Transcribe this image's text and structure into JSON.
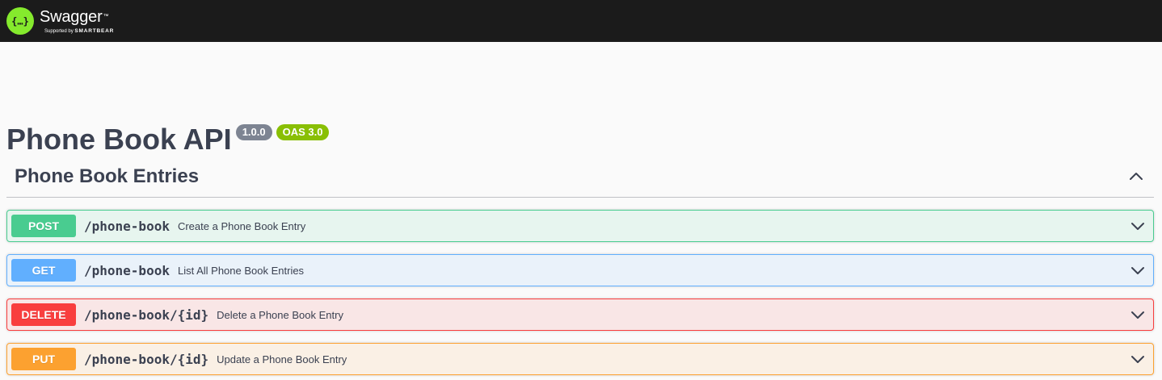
{
  "topbar": {
    "brand": "Swagger",
    "trademark": "™",
    "tagline_prefix": "Supported by",
    "tagline_brand": "SMARTBEAR",
    "logo_glyph": "{…}"
  },
  "info": {
    "title": "Phone Book API",
    "version": "1.0.0",
    "oas": "OAS 3.0"
  },
  "section": {
    "title": "Phone Book Entries",
    "toggle_icon": "chevron-up-icon"
  },
  "operations": [
    {
      "method": "POST",
      "path": "/phone-book",
      "summary": "Create a Phone Book Entry"
    },
    {
      "method": "GET",
      "path": "/phone-book",
      "summary": "List All Phone Book Entries"
    },
    {
      "method": "DELETE",
      "path": "/phone-book/{id}",
      "summary": "Delete a Phone Book Entry"
    },
    {
      "method": "PUT",
      "path": "/phone-book/{id}",
      "summary": "Update a Phone Book Entry"
    }
  ],
  "colors": {
    "topbar_bg": "#1b1b1b",
    "logo_green": "#85ea2d",
    "post": "#49cc90",
    "get": "#61affe",
    "delete": "#f93e3e",
    "put": "#fca130",
    "version_badge": "#7d8492",
    "oas_badge": "#89bf04"
  }
}
